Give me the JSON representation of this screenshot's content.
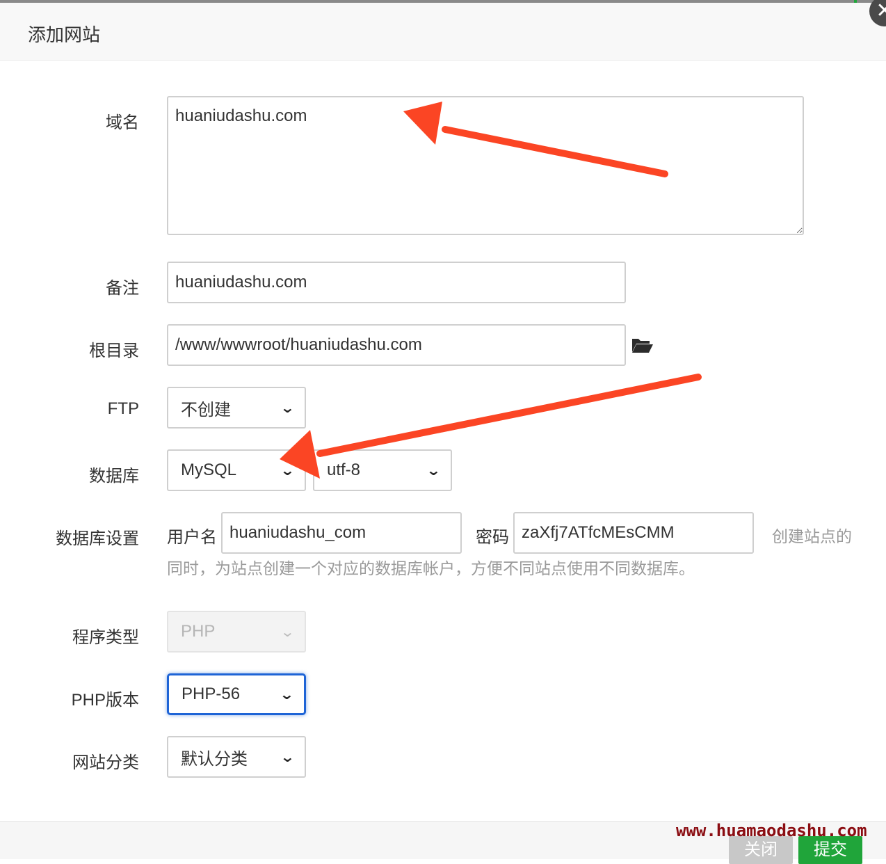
{
  "dialog": {
    "title": "添加网站",
    "close_icon": "close-icon"
  },
  "form": {
    "domain": {
      "label": "域名",
      "value": "huaniudashu.com"
    },
    "remark": {
      "label": "备注",
      "value": "huaniudashu.com"
    },
    "root": {
      "label": "根目录",
      "value": "/www/wwwroot/huaniudashu.com",
      "icon": "folder-open-icon"
    },
    "ftp": {
      "label": "FTP",
      "selected": "不创建"
    },
    "database": {
      "label": "数据库",
      "selected": "MySQL",
      "charset": "utf-8"
    },
    "db_settings": {
      "label": "数据库设置",
      "username_label": "用户名",
      "username": "huaniudashu_com",
      "password_label": "密码",
      "password": "zaXfj7ATfcMEsCMM",
      "hint_line1": "创建站点的",
      "hint_line2": "同时，为站点创建一个对应的数据库帐户，方便不同站点使用不同数据库。"
    },
    "program_type": {
      "label": "程序类型",
      "selected": "PHP"
    },
    "php_version": {
      "label": "PHP版本",
      "selected": "PHP-56"
    },
    "category": {
      "label": "网站分类",
      "selected": "默认分类"
    }
  },
  "footer": {
    "cancel_label": "关闭",
    "submit_label": "提交"
  },
  "watermark": "www.huamaodashu.com",
  "colors": {
    "submit": "#20a53a",
    "focus": "#1e64d6",
    "arrow": "#fb4524",
    "watermark": "#8b0d12"
  }
}
